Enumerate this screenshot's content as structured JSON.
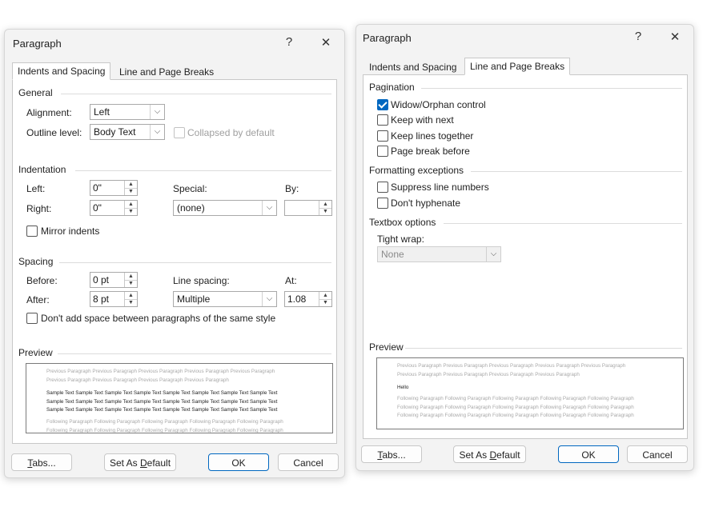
{
  "left_dialog": {
    "title": "Paragraph",
    "help_label": "?",
    "close_label": "✕",
    "tabs": [
      {
        "label": "Indents and Spacing",
        "active": true
      },
      {
        "label": "Line and Page Breaks",
        "active": false
      }
    ],
    "general": {
      "heading": "General",
      "alignment_label": "Alignment:",
      "alignment_value": "Left",
      "outline_label": "Outline level:",
      "outline_value": "Body Text",
      "collapsed_label": "Collapsed by default",
      "collapsed_checked": false
    },
    "indentation": {
      "heading": "Indentation",
      "left_label": "Left:",
      "left_value": "0\"",
      "right_label": "Right:",
      "right_value": "0\"",
      "special_label": "Special:",
      "special_value": "(none)",
      "by_label": "By:",
      "by_value": "",
      "mirror_label": "Mirror indents",
      "mirror_checked": false
    },
    "spacing": {
      "heading": "Spacing",
      "before_label": "Before:",
      "before_value": "0 pt",
      "after_label": "After:",
      "after_value": "8 pt",
      "line_spacing_label": "Line spacing:",
      "line_spacing_value": "Multiple",
      "at_label": "At:",
      "at_value": "1.08",
      "dont_add_label": "Don't add space between paragraphs of the same style",
      "dont_add_checked": false
    },
    "preview": {
      "heading": "Preview",
      "previous_text": "Previous Paragraph Previous Paragraph Previous Paragraph Previous Paragraph Previous Paragraph Previous Paragraph Previous Paragraph Previous Paragraph Previous Paragraph",
      "sample_text": "Sample Text Sample Text Sample Text Sample Text Sample Text Sample Text Sample Text Sample Text Sample Text Sample Text Sample Text Sample Text Sample Text Sample Text Sample Text Sample Text Sample Text Sample Text Sample Text Sample Text Sample Text Sample Text Sample Text Sample Text",
      "following_text": "Following Paragraph Following Paragraph Following Paragraph Following Paragraph Following Paragraph Following Paragraph Following Paragraph Following Paragraph Following Paragraph Following Paragraph Following Paragraph Following Paragraph"
    },
    "buttons": {
      "tabs": "Tabs...",
      "set_default": "Set As Default",
      "ok": "OK",
      "cancel": "Cancel"
    }
  },
  "right_dialog": {
    "title": "Paragraph",
    "help_label": "?",
    "close_label": "✕",
    "tabs": [
      {
        "label": "Indents and Spacing",
        "active": false
      },
      {
        "label": "Line and Page Breaks",
        "active": true
      }
    ],
    "pagination": {
      "heading": "Pagination",
      "items": [
        {
          "label": "Widow/Orphan control",
          "checked": true
        },
        {
          "label": "Keep with next",
          "checked": false
        },
        {
          "label": "Keep lines together",
          "checked": false
        },
        {
          "label": "Page break before",
          "checked": false
        }
      ]
    },
    "formatting": {
      "heading": "Formatting exceptions",
      "items": [
        {
          "label": "Suppress line numbers",
          "checked": false
        },
        {
          "label": "Don't hyphenate",
          "checked": false
        }
      ]
    },
    "textbox": {
      "heading": "Textbox options",
      "tight_wrap_label": "Tight wrap:",
      "tight_wrap_value": "None"
    },
    "preview": {
      "heading": "Preview",
      "previous_text": "Previous Paragraph Previous Paragraph Previous Paragraph Previous Paragraph Previous Paragraph Previous Paragraph Previous Paragraph Previous Paragraph Previous Paragraph",
      "sample_text": "Hello",
      "following_text": "Following Paragraph Following Paragraph Following Paragraph Following Paragraph Following Paragraph Following Paragraph Following Paragraph Following Paragraph Following Paragraph Following Paragraph Following Paragraph Following Paragraph Following Paragraph Following Paragraph Following Paragraph"
    },
    "buttons": {
      "tabs": "Tabs...",
      "set_default": "Set As Default",
      "ok": "OK",
      "cancel": "Cancel"
    }
  },
  "colors": {
    "accent": "#0067c0",
    "dialog_bg": "#f3f3f3",
    "preview_grey": "#a9a9a9"
  },
  "icons": {
    "dropdown": "chevron-down-icon",
    "spinner": "spin-arrows-icon",
    "close": "close-icon",
    "help": "help-icon",
    "checkbox": "checkbox-icon"
  }
}
